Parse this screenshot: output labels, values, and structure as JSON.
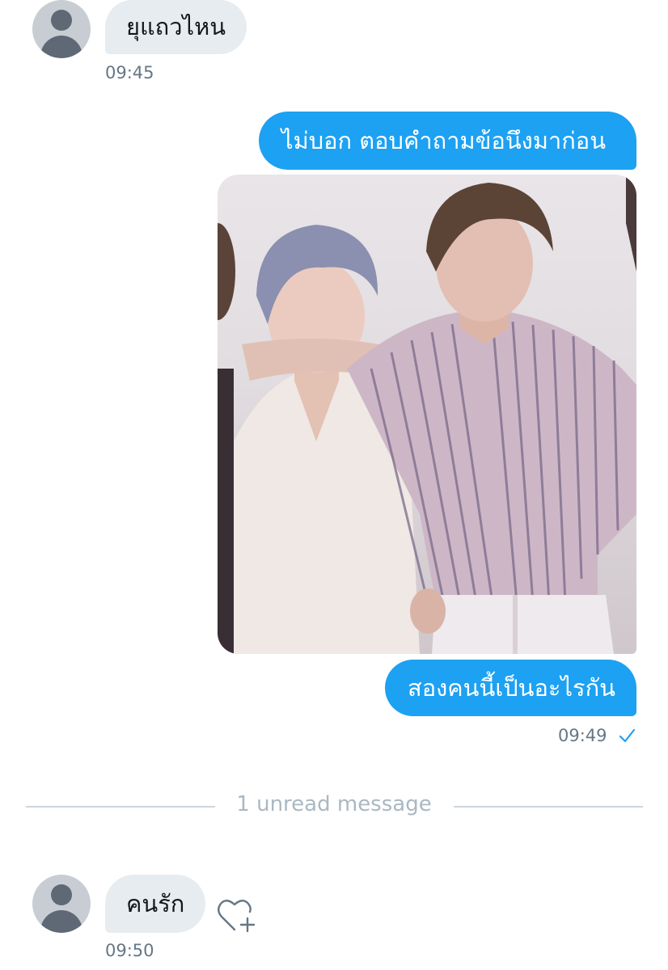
{
  "messages": [
    {
      "direction": "incoming",
      "text": "ยุแถวไหน",
      "time": "09:45"
    },
    {
      "direction": "outgoing",
      "text": "ไม่บอก ตอบคำถามข้อนึงมาก่อน"
    },
    {
      "direction": "outgoing",
      "type": "image",
      "description": "photo attachment"
    },
    {
      "direction": "outgoing",
      "text": "สองคนนี้เป็นอะไรกัน",
      "time": "09:49",
      "status_icon": "checkmark-icon"
    },
    {
      "direction": "incoming",
      "text": "คนรัก",
      "time": "09:50"
    }
  ],
  "divider": {
    "label": "1 unread message"
  },
  "colors": {
    "outgoing_bubble": "#1da1f2",
    "incoming_bubble": "#e6ecf0",
    "timestamp": "#657786",
    "divider": "#ccd6dd"
  },
  "icons": {
    "avatar": "default-avatar-icon",
    "reaction": "heart-plus-icon",
    "sent_status": "checkmark-icon"
  }
}
